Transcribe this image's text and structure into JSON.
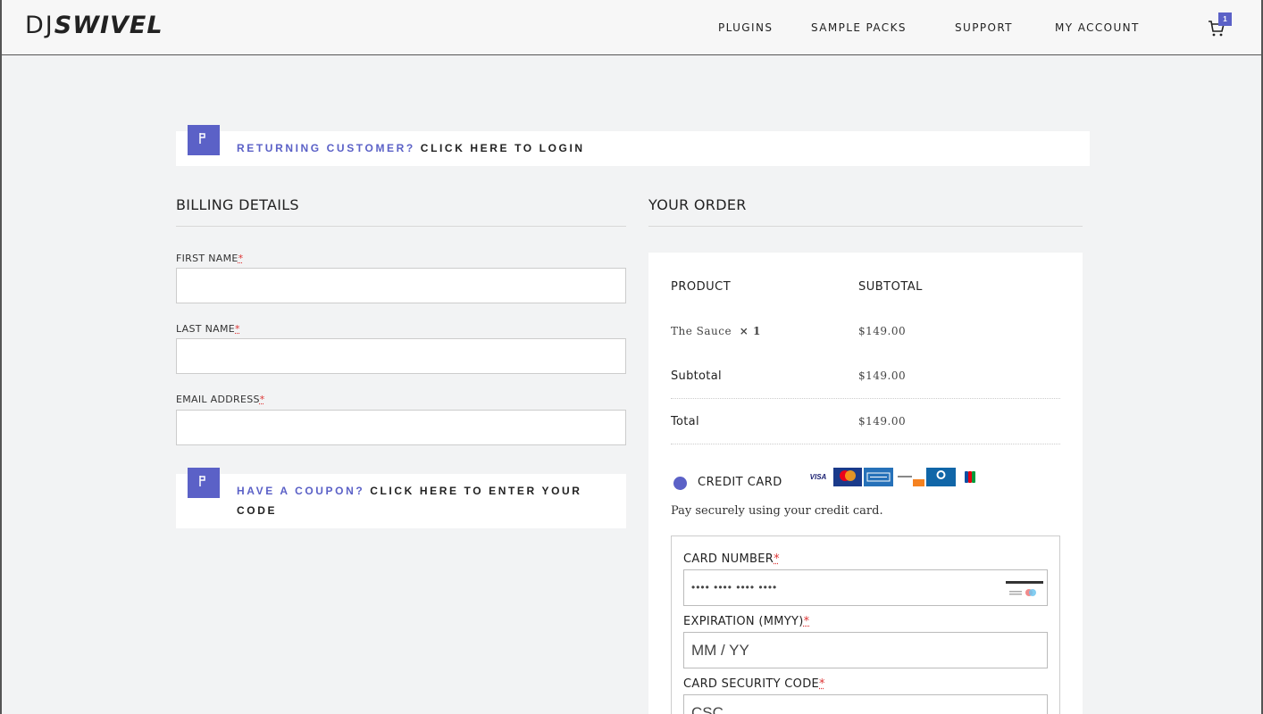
{
  "header": {
    "logo_light": "DJ",
    "logo_bold": "SWIVEL",
    "nav": [
      "PLUGINS",
      "SAMPLE PACKS",
      "SUPPORT",
      "MY ACCOUNT"
    ],
    "cart_count": "1"
  },
  "login_notice": {
    "prefix": "RETURNING CUSTOMER?",
    "link": "CLICK HERE TO LOGIN"
  },
  "billing": {
    "title": "BILLING DETAILS",
    "fields": [
      {
        "label": "FIRST NAME",
        "required": "*",
        "value": ""
      },
      {
        "label": "LAST NAME",
        "required": "*",
        "value": ""
      },
      {
        "label": "EMAIL ADDRESS",
        "required": "*",
        "value": ""
      }
    ]
  },
  "coupon_notice": {
    "prefix": "HAVE A COUPON?",
    "link": "CLICK HERE TO ENTER YOUR CODE"
  },
  "order": {
    "title": "YOUR ORDER",
    "col_product": "PRODUCT",
    "col_subtotal": "SUBTOTAL",
    "item_name": "The Sauce",
    "item_qty": "× 1",
    "item_price": "$149.00",
    "subtotal_label": "Subtotal",
    "subtotal_value": "$149.00",
    "total_label": "Total",
    "total_value": "$149.00"
  },
  "payment": {
    "method_label": "CREDIT CARD",
    "cards": [
      "VISA",
      "MASTERCARD",
      "AMEX",
      "DISCOVER",
      "DINERS",
      "JCB"
    ],
    "description": "Pay securely using your credit card.",
    "card_number_label": "CARD NUMBER",
    "card_number_placeholder": "•••• •••• •••• ••••",
    "expiration_label": "EXPIRATION (MMYY)",
    "expiration_placeholder": "MM / YY",
    "csc_label": "CARD SECURITY CODE",
    "csc_placeholder": "CSC",
    "required": "*"
  },
  "colors": {
    "accent": "#5b61c7",
    "background": "#f2f3f4",
    "required": "#d33333"
  }
}
